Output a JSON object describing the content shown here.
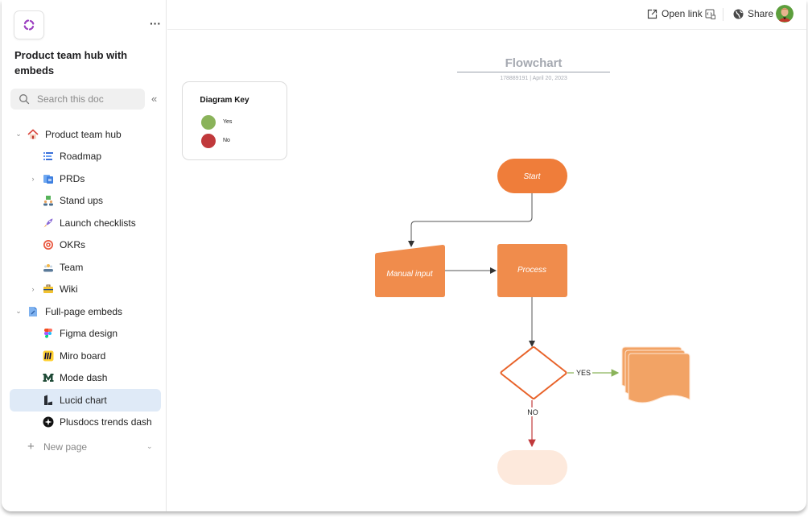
{
  "sidebar": {
    "doc_title": "Product team hub with embeds",
    "more_label": "···",
    "search_placeholder": "Search this doc",
    "collapse_label": "«",
    "items": [
      {
        "label": "Product team hub",
        "icon": "house-icon",
        "level": 0,
        "expander": "down"
      },
      {
        "label": "Roadmap",
        "icon": "roadmap-icon",
        "level": 1
      },
      {
        "label": "PRDs",
        "icon": "documents-icon",
        "level": 1,
        "expander": "right"
      },
      {
        "label": "Stand ups",
        "icon": "standup-people-icon",
        "level": 1
      },
      {
        "label": "Launch checklists",
        "icon": "rocket-icon",
        "level": 1
      },
      {
        "label": "OKRs",
        "icon": "target-icon",
        "level": 1
      },
      {
        "label": "Team",
        "icon": "team-icon",
        "level": 1
      },
      {
        "label": "Wiki",
        "icon": "toolbox-icon",
        "level": 1,
        "expander": "right"
      },
      {
        "label": "Full-page embeds",
        "icon": "embed-doc-icon",
        "level": 0,
        "expander": "down"
      },
      {
        "label": "Figma design",
        "icon": "figma-icon",
        "level": 1
      },
      {
        "label": "Miro board",
        "icon": "miro-icon",
        "level": 1
      },
      {
        "label": "Mode dash",
        "icon": "mode-icon",
        "level": 1
      },
      {
        "label": "Lucid chart",
        "icon": "lucid-icon",
        "level": 1,
        "active": true
      },
      {
        "label": "Plusdocs trends dash",
        "icon": "plusdocs-icon",
        "level": 1
      }
    ],
    "new_page_label": "New page"
  },
  "topbar": {
    "open_link_label": "Open link",
    "share_label": "Share"
  },
  "diagram": {
    "title": "Flowchart",
    "subtitle": "178889191  |  April 20, 2023",
    "key": {
      "title": "Diagram Key",
      "entries": [
        {
          "label": "Yes",
          "color": "#8ab35a"
        },
        {
          "label": "No",
          "color": "#c0393b"
        }
      ]
    },
    "nodes": {
      "start": "Start",
      "manual_input": "Manual input",
      "process": "Process"
    },
    "edges": {
      "yes_label": "YES",
      "no_label": "NO"
    },
    "colors": {
      "orange_dark": "#ef7d3a",
      "orange": "#f08c4c",
      "orange_light": "#f2a365",
      "peach": "#fde9dc",
      "diamond_stroke": "#e8632a",
      "yes_line": "#8ab35a",
      "no_line": "#c0393b"
    }
  }
}
